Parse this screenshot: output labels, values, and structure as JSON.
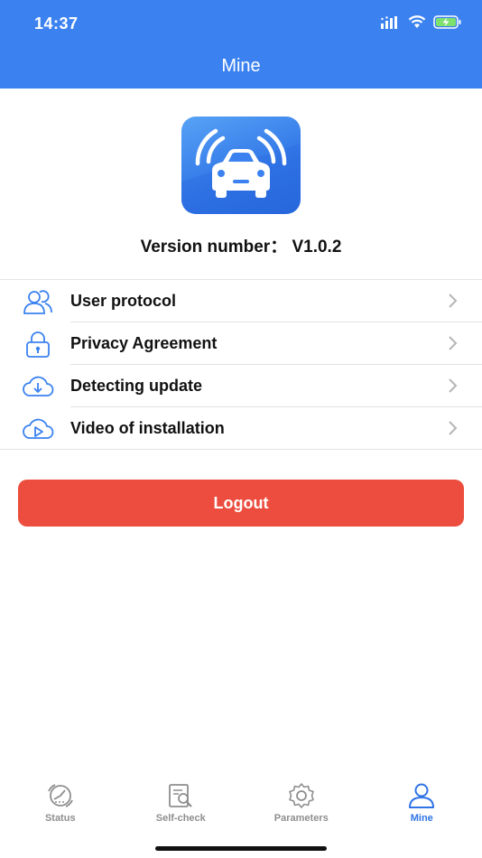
{
  "status_bar": {
    "time": "14:37",
    "icons": [
      "signal-icon",
      "wifi-icon",
      "battery-charging-icon"
    ]
  },
  "header": {
    "title": "Mine"
  },
  "app": {
    "icon": "car-sensor-logo",
    "version_text": "Version number：  V1.0.2"
  },
  "menu": {
    "items": [
      {
        "label": "User protocol",
        "icon": "users-icon"
      },
      {
        "label": "Privacy Agreement",
        "icon": "lock-icon"
      },
      {
        "label": "Detecting update",
        "icon": "cloud-download-icon"
      },
      {
        "label": "Video of installation",
        "icon": "cloud-play-icon"
      }
    ],
    "chevron_icon": "chevron-right-icon"
  },
  "logout": {
    "label": "Logout",
    "color": "#ec4d3e"
  },
  "tabbar": {
    "tabs": [
      {
        "label": "Status",
        "icon": "speedometer-icon",
        "active": false
      },
      {
        "label": "Self-check",
        "icon": "document-search-icon",
        "active": false
      },
      {
        "label": "Parameters",
        "icon": "gear-icon",
        "active": false
      },
      {
        "label": "Mine",
        "icon": "person-icon",
        "active": true
      }
    ]
  },
  "colors": {
    "brand": "#3b82f0",
    "active_tab": "#2f74e6",
    "inactive_tab": "#8e8e8e"
  }
}
